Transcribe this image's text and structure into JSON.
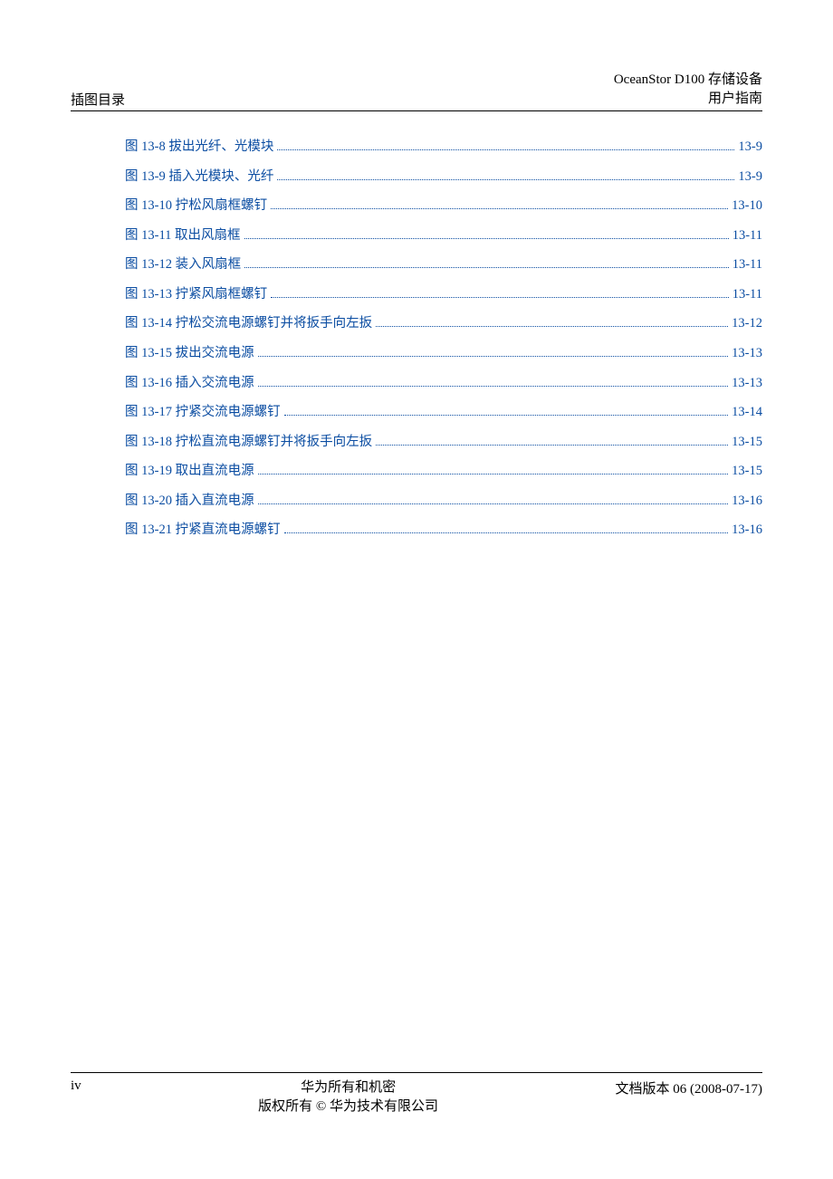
{
  "header": {
    "left": "插图目录",
    "right_line1": "OceanStor D100  存储设备",
    "right_line2": "用户指南"
  },
  "toc": [
    {
      "label": "图 13-8  拔出光纤、光模块",
      "page": "13-9"
    },
    {
      "label": "图 13-9  插入光模块、光纤",
      "page": "13-9"
    },
    {
      "label": "图 13-10  拧松风扇框螺钉",
      "page": "13-10"
    },
    {
      "label": "图 13-11  取出风扇框",
      "page": "13-11"
    },
    {
      "label": "图 13-12  装入风扇框",
      "page": "13-11"
    },
    {
      "label": "图 13-13  拧紧风扇框螺钉",
      "page": "13-11"
    },
    {
      "label": "图 13-14  拧松交流电源螺钉并将扳手向左扳",
      "page": "13-12"
    },
    {
      "label": "图 13-15  拔出交流电源",
      "page": "13-13"
    },
    {
      "label": "图 13-16  插入交流电源",
      "page": "13-13"
    },
    {
      "label": "图 13-17  拧紧交流电源螺钉",
      "page": "13-14"
    },
    {
      "label": "图 13-18  拧松直流电源螺钉并将扳手向左扳",
      "page": "13-15"
    },
    {
      "label": "图 13-19  取出直流电源",
      "page": "13-15"
    },
    {
      "label": "图 13-20  插入直流电源",
      "page": "13-16"
    },
    {
      "label": "图 13-21  拧紧直流电源螺钉",
      "page": "13-16"
    }
  ],
  "footer": {
    "left": "iv",
    "center_line1": "华为所有和机密",
    "center_line2": "版权所有  ©  华为技术有限公司",
    "right": "文档版本  06 (2008-07-17)"
  }
}
